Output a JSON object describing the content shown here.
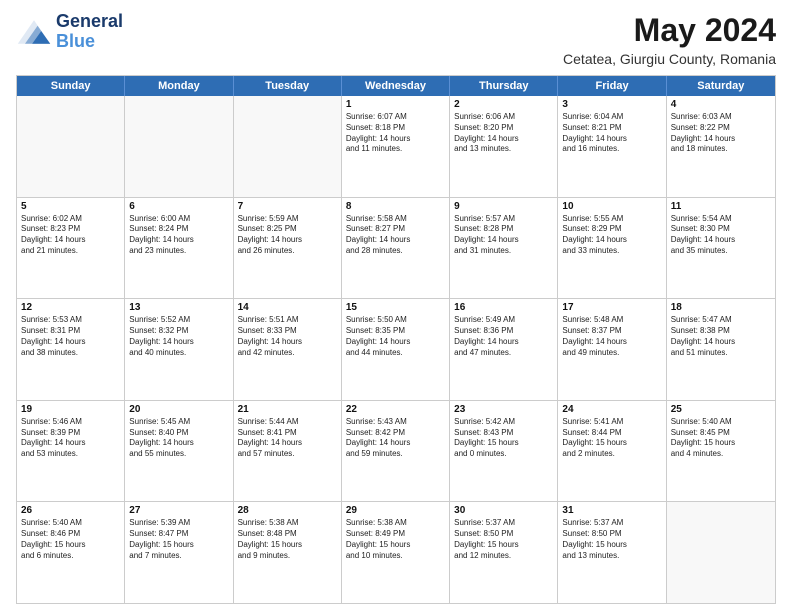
{
  "header": {
    "logo_general": "General",
    "logo_blue": "Blue",
    "main_title": "May 2024",
    "subtitle": "Cetatea, Giurgiu County, Romania"
  },
  "days_of_week": [
    "Sunday",
    "Monday",
    "Tuesday",
    "Wednesday",
    "Thursday",
    "Friday",
    "Saturday"
  ],
  "weeks": [
    [
      {
        "day": "",
        "empty": true
      },
      {
        "day": "",
        "empty": true
      },
      {
        "day": "",
        "empty": true
      },
      {
        "day": "1",
        "lines": [
          "Sunrise: 6:07 AM",
          "Sunset: 8:18 PM",
          "Daylight: 14 hours",
          "and 11 minutes."
        ]
      },
      {
        "day": "2",
        "lines": [
          "Sunrise: 6:06 AM",
          "Sunset: 8:20 PM",
          "Daylight: 14 hours",
          "and 13 minutes."
        ]
      },
      {
        "day": "3",
        "lines": [
          "Sunrise: 6:04 AM",
          "Sunset: 8:21 PM",
          "Daylight: 14 hours",
          "and 16 minutes."
        ]
      },
      {
        "day": "4",
        "lines": [
          "Sunrise: 6:03 AM",
          "Sunset: 8:22 PM",
          "Daylight: 14 hours",
          "and 18 minutes."
        ]
      }
    ],
    [
      {
        "day": "5",
        "lines": [
          "Sunrise: 6:02 AM",
          "Sunset: 8:23 PM",
          "Daylight: 14 hours",
          "and 21 minutes."
        ]
      },
      {
        "day": "6",
        "lines": [
          "Sunrise: 6:00 AM",
          "Sunset: 8:24 PM",
          "Daylight: 14 hours",
          "and 23 minutes."
        ]
      },
      {
        "day": "7",
        "lines": [
          "Sunrise: 5:59 AM",
          "Sunset: 8:25 PM",
          "Daylight: 14 hours",
          "and 26 minutes."
        ]
      },
      {
        "day": "8",
        "lines": [
          "Sunrise: 5:58 AM",
          "Sunset: 8:27 PM",
          "Daylight: 14 hours",
          "and 28 minutes."
        ]
      },
      {
        "day": "9",
        "lines": [
          "Sunrise: 5:57 AM",
          "Sunset: 8:28 PM",
          "Daylight: 14 hours",
          "and 31 minutes."
        ]
      },
      {
        "day": "10",
        "lines": [
          "Sunrise: 5:55 AM",
          "Sunset: 8:29 PM",
          "Daylight: 14 hours",
          "and 33 minutes."
        ]
      },
      {
        "day": "11",
        "lines": [
          "Sunrise: 5:54 AM",
          "Sunset: 8:30 PM",
          "Daylight: 14 hours",
          "and 35 minutes."
        ]
      }
    ],
    [
      {
        "day": "12",
        "lines": [
          "Sunrise: 5:53 AM",
          "Sunset: 8:31 PM",
          "Daylight: 14 hours",
          "and 38 minutes."
        ]
      },
      {
        "day": "13",
        "lines": [
          "Sunrise: 5:52 AM",
          "Sunset: 8:32 PM",
          "Daylight: 14 hours",
          "and 40 minutes."
        ]
      },
      {
        "day": "14",
        "lines": [
          "Sunrise: 5:51 AM",
          "Sunset: 8:33 PM",
          "Daylight: 14 hours",
          "and 42 minutes."
        ]
      },
      {
        "day": "15",
        "lines": [
          "Sunrise: 5:50 AM",
          "Sunset: 8:35 PM",
          "Daylight: 14 hours",
          "and 44 minutes."
        ]
      },
      {
        "day": "16",
        "lines": [
          "Sunrise: 5:49 AM",
          "Sunset: 8:36 PM",
          "Daylight: 14 hours",
          "and 47 minutes."
        ]
      },
      {
        "day": "17",
        "lines": [
          "Sunrise: 5:48 AM",
          "Sunset: 8:37 PM",
          "Daylight: 14 hours",
          "and 49 minutes."
        ]
      },
      {
        "day": "18",
        "lines": [
          "Sunrise: 5:47 AM",
          "Sunset: 8:38 PM",
          "Daylight: 14 hours",
          "and 51 minutes."
        ]
      }
    ],
    [
      {
        "day": "19",
        "lines": [
          "Sunrise: 5:46 AM",
          "Sunset: 8:39 PM",
          "Daylight: 14 hours",
          "and 53 minutes."
        ]
      },
      {
        "day": "20",
        "lines": [
          "Sunrise: 5:45 AM",
          "Sunset: 8:40 PM",
          "Daylight: 14 hours",
          "and 55 minutes."
        ]
      },
      {
        "day": "21",
        "lines": [
          "Sunrise: 5:44 AM",
          "Sunset: 8:41 PM",
          "Daylight: 14 hours",
          "and 57 minutes."
        ]
      },
      {
        "day": "22",
        "lines": [
          "Sunrise: 5:43 AM",
          "Sunset: 8:42 PM",
          "Daylight: 14 hours",
          "and 59 minutes."
        ]
      },
      {
        "day": "23",
        "lines": [
          "Sunrise: 5:42 AM",
          "Sunset: 8:43 PM",
          "Daylight: 15 hours",
          "and 0 minutes."
        ]
      },
      {
        "day": "24",
        "lines": [
          "Sunrise: 5:41 AM",
          "Sunset: 8:44 PM",
          "Daylight: 15 hours",
          "and 2 minutes."
        ]
      },
      {
        "day": "25",
        "lines": [
          "Sunrise: 5:40 AM",
          "Sunset: 8:45 PM",
          "Daylight: 15 hours",
          "and 4 minutes."
        ]
      }
    ],
    [
      {
        "day": "26",
        "lines": [
          "Sunrise: 5:40 AM",
          "Sunset: 8:46 PM",
          "Daylight: 15 hours",
          "and 6 minutes."
        ]
      },
      {
        "day": "27",
        "lines": [
          "Sunrise: 5:39 AM",
          "Sunset: 8:47 PM",
          "Daylight: 15 hours",
          "and 7 minutes."
        ]
      },
      {
        "day": "28",
        "lines": [
          "Sunrise: 5:38 AM",
          "Sunset: 8:48 PM",
          "Daylight: 15 hours",
          "and 9 minutes."
        ]
      },
      {
        "day": "29",
        "lines": [
          "Sunrise: 5:38 AM",
          "Sunset: 8:49 PM",
          "Daylight: 15 hours",
          "and 10 minutes."
        ]
      },
      {
        "day": "30",
        "lines": [
          "Sunrise: 5:37 AM",
          "Sunset: 8:50 PM",
          "Daylight: 15 hours",
          "and 12 minutes."
        ]
      },
      {
        "day": "31",
        "lines": [
          "Sunrise: 5:37 AM",
          "Sunset: 8:50 PM",
          "Daylight: 15 hours",
          "and 13 minutes."
        ]
      },
      {
        "day": "",
        "empty": true
      }
    ]
  ]
}
